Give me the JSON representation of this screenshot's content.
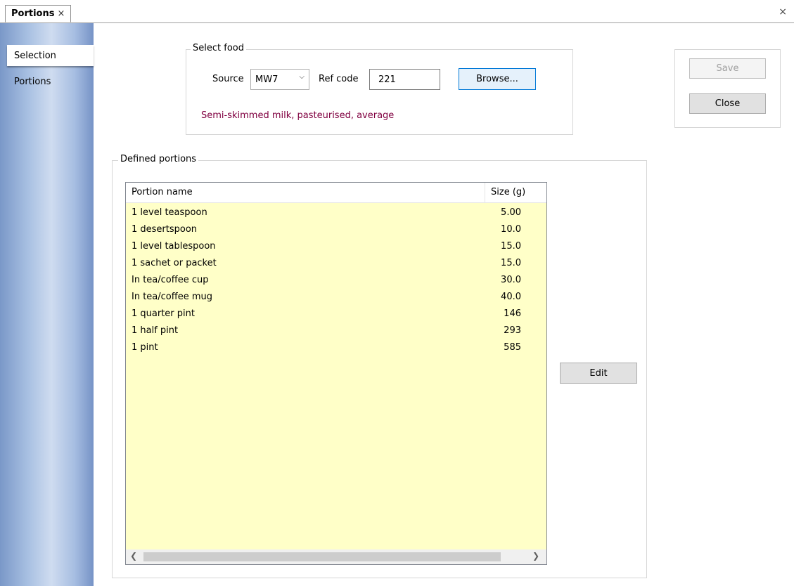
{
  "tab": {
    "title": "Portions",
    "close_glyph": "×"
  },
  "window_close_glyph": "×",
  "sidebar": {
    "items": [
      {
        "label": "Selection",
        "selected": true
      },
      {
        "label": "Portions",
        "selected": false
      }
    ]
  },
  "select_food": {
    "legend": "Select food",
    "source_label": "Source",
    "source_value": "MW7",
    "ref_code_label": "Ref code",
    "ref_code_value": "221",
    "browse_label": "Browse...",
    "description": "Semi-skimmed milk, pasteurised, average"
  },
  "actions": {
    "save_label": "Save",
    "close_label": "Close"
  },
  "defined_portions": {
    "legend": "Defined portions",
    "columns": [
      "Portion name",
      "Size (g)"
    ],
    "rows": [
      {
        "name": "1 level teaspoon",
        "size": "5.00"
      },
      {
        "name": "1 desertspoon",
        "size": "10.0"
      },
      {
        "name": "1 level tablespoon",
        "size": "15.0"
      },
      {
        "name": "1 sachet or packet",
        "size": "15.0"
      },
      {
        "name": "In tea/coffee cup",
        "size": "30.0"
      },
      {
        "name": "In tea/coffee mug",
        "size": "40.0"
      },
      {
        "name": "1 quarter pint",
        "size": "146"
      },
      {
        "name": "1 half pint",
        "size": "293"
      },
      {
        "name": "1 pint",
        "size": "585"
      }
    ],
    "edit_label": "Edit"
  },
  "colors": {
    "list_background": "#ffffc8",
    "description_text": "#800040",
    "focus_border": "#0078d7"
  },
  "icons": {
    "scroll_left": "chevron-left-icon",
    "scroll_right": "chevron-right-icon",
    "dropdown": "chevron-down-icon"
  }
}
